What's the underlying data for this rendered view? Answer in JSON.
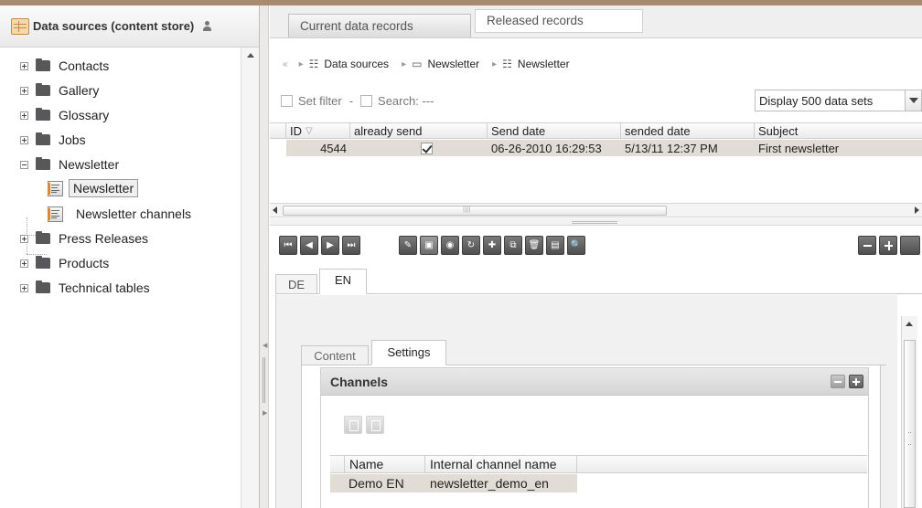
{
  "sidebar": {
    "title": "Data sources (content store)",
    "items": [
      {
        "label": "Contacts"
      },
      {
        "label": "Gallery"
      },
      {
        "label": "Glossary"
      },
      {
        "label": "Jobs"
      },
      {
        "label": "Newsletter"
      },
      {
        "label": "Newsletter"
      },
      {
        "label": "Newsletter channels"
      },
      {
        "label": "Press Releases"
      },
      {
        "label": "Products"
      },
      {
        "label": "Technical tables"
      }
    ]
  },
  "top_tabs": {
    "current": "Current data records",
    "released": "Released records"
  },
  "breadcrumb": {
    "items": [
      "Data sources",
      "Newsletter",
      "Newsletter"
    ]
  },
  "filter": {
    "set_filter": "Set filter",
    "separator": "-",
    "search": "Search: ---",
    "display": "Display 500 data sets"
  },
  "grid": {
    "columns": [
      "ID",
      "already send",
      "Send date",
      "sended date",
      "Subject"
    ],
    "rows": [
      {
        "id": "4544",
        "already_send": true,
        "send_date": "06-26-2010 16:29:53",
        "sended_date": "5/13/11 12:37 PM",
        "subject": "First newsletter"
      }
    ]
  },
  "lang_tabs": {
    "de": "DE",
    "en": "EN"
  },
  "settings_tabs": {
    "content": "Content",
    "settings": "Settings"
  },
  "channels": {
    "title": "Channels",
    "columns": [
      "Name",
      "Internal channel name"
    ],
    "rows": [
      {
        "name": "Demo EN",
        "internal": "newsletter_demo_en"
      }
    ]
  },
  "colors": {
    "top_accent": "#a88b6e",
    "selected_row": "#e1ddd6",
    "folder_icon": "#58575a"
  }
}
